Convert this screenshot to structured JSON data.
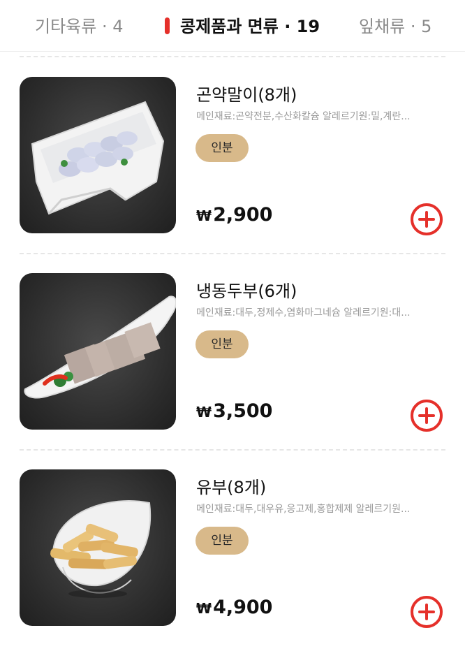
{
  "tabs": [
    {
      "label": "기타육류 · 4",
      "active": false
    },
    {
      "label": "콩제품과 면류 · 19",
      "active": true
    },
    {
      "label": "잎채류 · 5",
      "active": false
    }
  ],
  "colors": {
    "accent": "#e5302a",
    "badge_bg": "#d8b98a",
    "muted_text": "#9a9a9a"
  },
  "items": [
    {
      "name": "곤약말이(8개)",
      "description": "메인재료:곤약전분,수산화칼슘 알레르기원:밀,계란...",
      "badge": "인분",
      "currency": "₩",
      "price": "2,900",
      "add_icon": "plus-circle-icon"
    },
    {
      "name": "냉동두부(6개)",
      "description": "메인재료:대두,정제수,염화마그네슘 알레르기원:대...",
      "badge": "인분",
      "currency": "₩",
      "price": "3,500",
      "add_icon": "plus-circle-icon"
    },
    {
      "name": "유부(8개)",
      "description": "메인재료:대두,대우유,응고제,홍합제제 알레르기원...",
      "badge": "인분",
      "currency": "₩",
      "price": "4,900",
      "add_icon": "plus-circle-icon"
    }
  ]
}
